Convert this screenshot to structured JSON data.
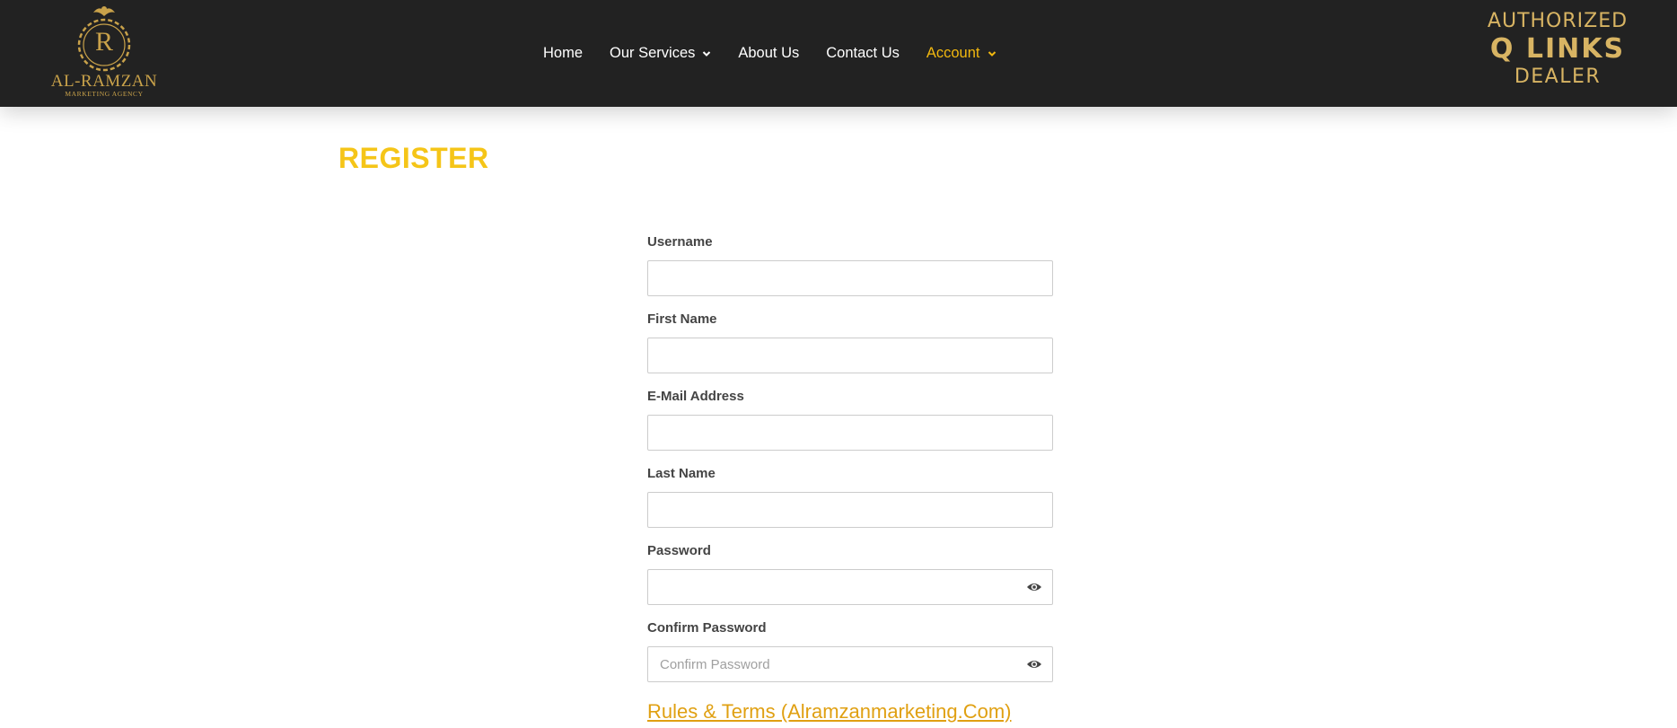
{
  "header": {
    "logo_left": {
      "letter": "R",
      "brand": "AL-RAMZAN",
      "tagline": "MARKETING AGENCY"
    },
    "nav": [
      {
        "label": "Home",
        "has_dropdown": false,
        "active": false
      },
      {
        "label": "Our Services",
        "has_dropdown": true,
        "active": false
      },
      {
        "label": "About Us",
        "has_dropdown": false,
        "active": false
      },
      {
        "label": "Contact Us",
        "has_dropdown": false,
        "active": false
      },
      {
        "label": "Account",
        "has_dropdown": true,
        "active": true
      }
    ],
    "logo_right": {
      "line1": "AUTHORIZED",
      "line2": "Q LINKS",
      "line3": "DEALER"
    }
  },
  "page": {
    "title": "REGISTER"
  },
  "form": {
    "fields": [
      {
        "label": "Username",
        "value": "",
        "placeholder": ""
      },
      {
        "label": "First Name",
        "value": "",
        "placeholder": ""
      },
      {
        "label": "E-Mail Address",
        "value": "",
        "placeholder": ""
      },
      {
        "label": "Last Name",
        "value": "",
        "placeholder": ""
      },
      {
        "label": "Password",
        "value": "",
        "placeholder": ""
      },
      {
        "label": "Confirm Password",
        "value": "",
        "placeholder": "Confirm Password"
      }
    ],
    "rules_link": "Rules & Terms (Alramzanmarketing.Com)"
  },
  "colors": {
    "header_bg": "#222222",
    "accent_yellow": "#f5c518",
    "gold": "#c9a24a",
    "link_gold": "#e0a012"
  },
  "icons": {
    "password_toggle": "eye-icon",
    "dropdown": "chevron-down-icon"
  }
}
